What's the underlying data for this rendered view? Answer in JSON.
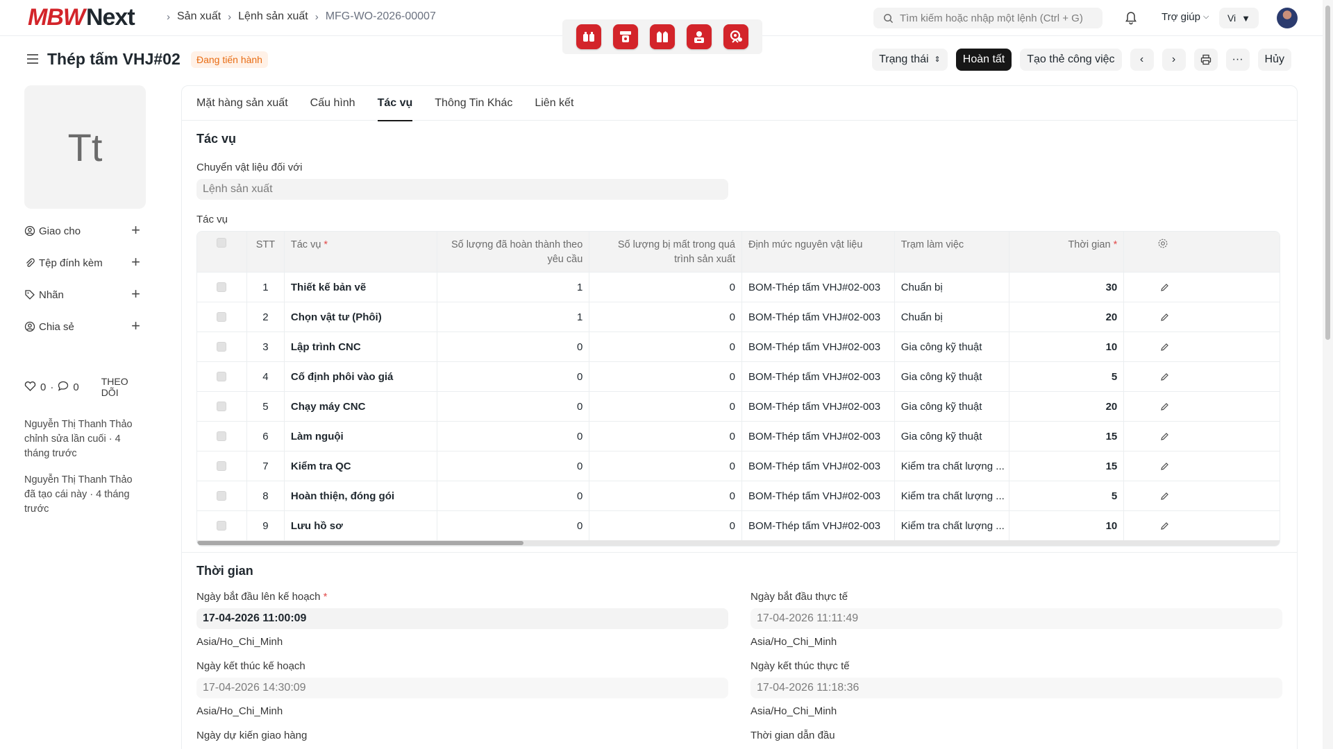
{
  "brand": {
    "logo_brand": "MBW",
    "logo_next": "Next",
    "accent": "#d3242a"
  },
  "breadcrumb": {
    "items": [
      "Sản xuất",
      "Lệnh sản xuất",
      "MFG-WO-2026-00007"
    ]
  },
  "search": {
    "placeholder": "Tìm kiếm hoặc nhập một lệnh (Ctrl + G)"
  },
  "navbar": {
    "help": "Trợ giúp",
    "lang": "Vi"
  },
  "page": {
    "title": "Thép tấm VHJ#02",
    "status": "Đang tiến hành"
  },
  "actions": {
    "status": "Trạng thái",
    "complete": "Hoàn tất",
    "job_card": "Tạo thẻ công việc",
    "more": "···",
    "cancel": "Hủy"
  },
  "sidebar": {
    "avatar": "Tt",
    "items": [
      "Giao cho",
      "Tệp đính kèm",
      "Nhãn",
      "Chia sẻ"
    ],
    "likes": "0",
    "comments": "0",
    "follow": "THEO DÕI",
    "activity": [
      "Nguyễn Thị Thanh Thảo chỉnh sửa lần cuối · 4 tháng trước",
      "Nguyễn Thị Thanh Thảo đã tạo cái này · 4 tháng trước"
    ]
  },
  "tabs": [
    "Mặt hàng sản xuất",
    "Cấu hình",
    "Tác vụ",
    "Thông Tin Khác",
    "Liên kết"
  ],
  "tasks": {
    "title": "Tác vụ",
    "transfer_label": "Chuyển vật liệu đối với",
    "transfer_value": "Lệnh sản xuất",
    "table_label": "Tác vụ",
    "headers": {
      "no": "STT",
      "operation": "Tác vụ",
      "completed": "Số lượng đã hoàn thành theo yêu cầu",
      "lost": "Số lượng bị mất trong quá trình sản xuất",
      "bom": "Định mức nguyên vật liệu",
      "workstation": "Trạm làm việc",
      "time": "Thời gian"
    },
    "rows": [
      {
        "no": "1",
        "op": "Thiết kế bản vẽ",
        "done": "1",
        "lost": "0",
        "bom": "BOM-Thép tấm VHJ#02-003",
        "ws": "Chuẩn bị",
        "time": "30"
      },
      {
        "no": "2",
        "op": "Chọn vật tư (Phôi)",
        "done": "1",
        "lost": "0",
        "bom": "BOM-Thép tấm VHJ#02-003",
        "ws": "Chuẩn bị",
        "time": "20"
      },
      {
        "no": "3",
        "op": "Lập trình CNC",
        "done": "0",
        "lost": "0",
        "bom": "BOM-Thép tấm VHJ#02-003",
        "ws": "Gia công kỹ thuật",
        "time": "10"
      },
      {
        "no": "4",
        "op": "Cố định phôi vào giá",
        "done": "0",
        "lost": "0",
        "bom": "BOM-Thép tấm VHJ#02-003",
        "ws": "Gia công kỹ thuật",
        "time": "5"
      },
      {
        "no": "5",
        "op": "Chạy máy CNC",
        "done": "0",
        "lost": "0",
        "bom": "BOM-Thép tấm VHJ#02-003",
        "ws": "Gia công kỹ thuật",
        "time": "20"
      },
      {
        "no": "6",
        "op": "Làm nguội",
        "done": "0",
        "lost": "0",
        "bom": "BOM-Thép tấm VHJ#02-003",
        "ws": "Gia công kỹ thuật",
        "time": "15"
      },
      {
        "no": "7",
        "op": "Kiểm tra QC",
        "done": "0",
        "lost": "0",
        "bom": "BOM-Thép tấm VHJ#02-003",
        "ws": "Kiểm tra chất lượng ...",
        "time": "15"
      },
      {
        "no": "8",
        "op": "Hoàn thiện, đóng gói",
        "done": "0",
        "lost": "0",
        "bom": "BOM-Thép tấm VHJ#02-003",
        "ws": "Kiểm tra chất lượng ...",
        "time": "5"
      },
      {
        "no": "9",
        "op": "Lưu hồ sơ",
        "done": "0",
        "lost": "0",
        "bom": "BOM-Thép tấm VHJ#02-003",
        "ws": "Kiểm tra chất lượng ...",
        "time": "10"
      }
    ]
  },
  "timing": {
    "title": "Thời gian",
    "planned_start_label": "Ngày bắt đầu lên kế hoạch",
    "planned_start": "17-04-2026 11:00:09",
    "actual_start_label": "Ngày bắt đầu thực tế",
    "actual_start": "17-04-2026 11:11:49",
    "planned_end_label": "Ngày kết thúc kế hoạch",
    "planned_end": "17-04-2026 14:30:09",
    "actual_end_label": "Ngày kết thúc thực tế",
    "actual_end": "17-04-2026 11:18:36",
    "timezone": "Asia/Ho_Chi_Minh",
    "expected_delivery_label": "Ngày dự kiến giao hàng",
    "lead_time_label": "Thời gian dẫn đầu"
  }
}
